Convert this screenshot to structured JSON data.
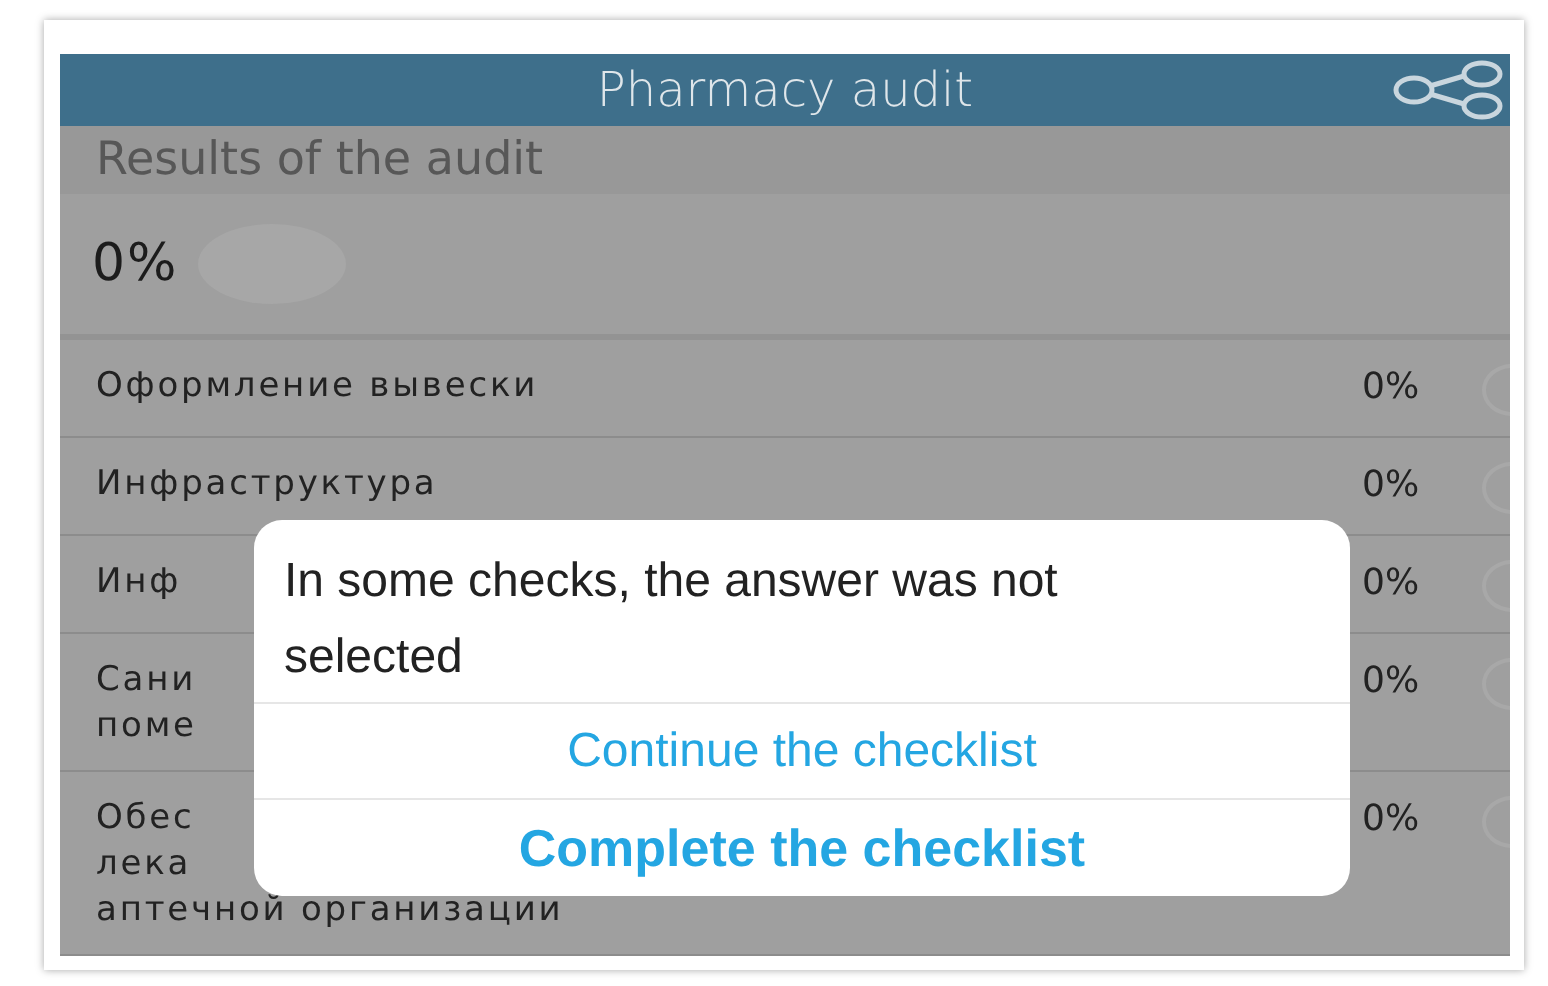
{
  "title_bar": {
    "title": "Pharmacy audit"
  },
  "results": {
    "heading": "Results of the audit",
    "overall": "0%"
  },
  "sections": [
    {
      "lines": [
        "Оформление вывески"
      ],
      "percent": "0%"
    },
    {
      "lines": [
        "Инфраструктура"
      ],
      "percent": "0%"
    },
    {
      "lines": [
        "Инф"
      ],
      "percent": "0%"
    },
    {
      "lines": [
        "Сани",
        "поме"
      ],
      "percent": "0%"
    },
    {
      "lines": [
        "Обес",
        "лека",
        "аптечной организации"
      ],
      "percent": "0%"
    }
  ],
  "dialog": {
    "message": "In some checks, the answer was not selected",
    "buttons": [
      {
        "label": "Continue the checklist",
        "kind": "default"
      },
      {
        "label": "Complete the checklist",
        "kind": "primary"
      }
    ]
  }
}
